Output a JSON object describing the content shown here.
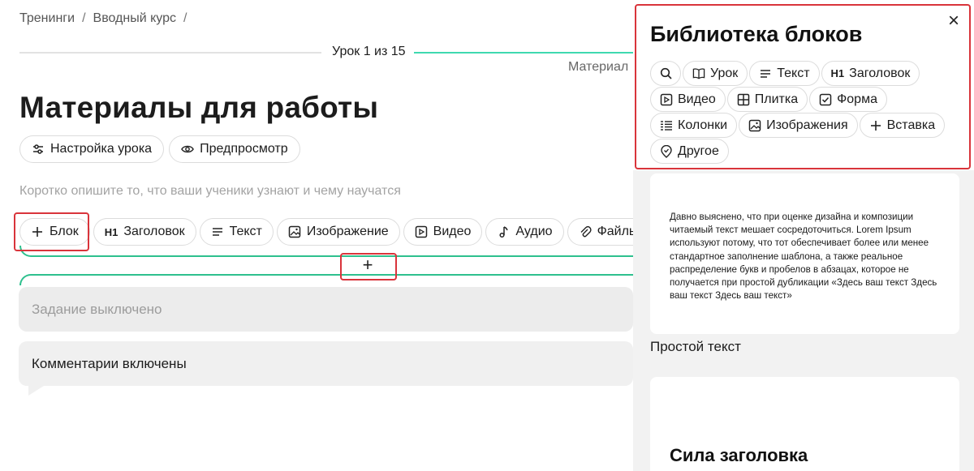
{
  "breadcrumb": {
    "items": [
      "Тренинги",
      "Вводный курс"
    ],
    "separator": "/"
  },
  "progress": {
    "label": "Урок 1 из 15",
    "material_label": "Материал",
    "accent_color": "#3fd9b0"
  },
  "page": {
    "title": "Материалы для работы"
  },
  "settings_bar": {
    "lesson_settings": {
      "label": "Настройка урока",
      "icon": "sliders-icon"
    },
    "preview": {
      "label": "Предпросмотр",
      "icon": "eye-icon"
    }
  },
  "description_placeholder": "Коротко опишите то, что ваши ученики узнают и чему научатся",
  "block_bar": {
    "block": {
      "label": "Блок",
      "icon": "plus-icon"
    },
    "heading": {
      "label": "Заголовок",
      "icon_text": "H1"
    },
    "text": {
      "label": "Текст",
      "icon": "lines-icon"
    },
    "image": {
      "label": "Изображение",
      "icon": "image-icon"
    },
    "video": {
      "label": "Видео",
      "icon": "play-icon"
    },
    "audio": {
      "label": "Аудио",
      "icon": "note-icon"
    },
    "files": {
      "label": "Файлы",
      "icon": "paperclip-icon"
    }
  },
  "insert_plus": "+",
  "task": {
    "label": "Задание выключено"
  },
  "comments": {
    "label": "Комментарии включены"
  },
  "library": {
    "title": "Библиотека блоков",
    "close": "×",
    "chips": {
      "lesson": {
        "label": "Урок",
        "icon": "book-icon"
      },
      "text": {
        "label": "Текст",
        "icon": "lines-icon"
      },
      "heading": {
        "label": "Заголовок",
        "icon_text": "H1"
      },
      "video": {
        "label": "Видео",
        "icon": "play-icon"
      },
      "tile": {
        "label": "Плитка",
        "icon": "grid-icon"
      },
      "form": {
        "label": "Форма",
        "icon": "checkbox-icon"
      },
      "columns": {
        "label": "Колонки",
        "icon": "columns-icon"
      },
      "images": {
        "label": "Изображения",
        "icon": "image-icon"
      },
      "embed": {
        "label": "Вставка",
        "icon": "plus-icon"
      },
      "other": {
        "label": "Другое",
        "icon": "pin-icon"
      }
    },
    "card1_text": "Давно выяснено, что при оценке дизайна и композиции читаемый текст мешает сосредоточиться. Lorem Ipsum используют потому, что тот обеспечивает более или менее стандартное заполнение шаблона, а также реальное распределение букв и пробелов в абзацах, которое не получается при простой дубликации «Здесь ваш текст Здесь ваш текст Здесь ваш текст»",
    "card1_caption": "Простой текст",
    "card2_heading": "Сила заголовка"
  },
  "highlight_color": "#d9343b"
}
